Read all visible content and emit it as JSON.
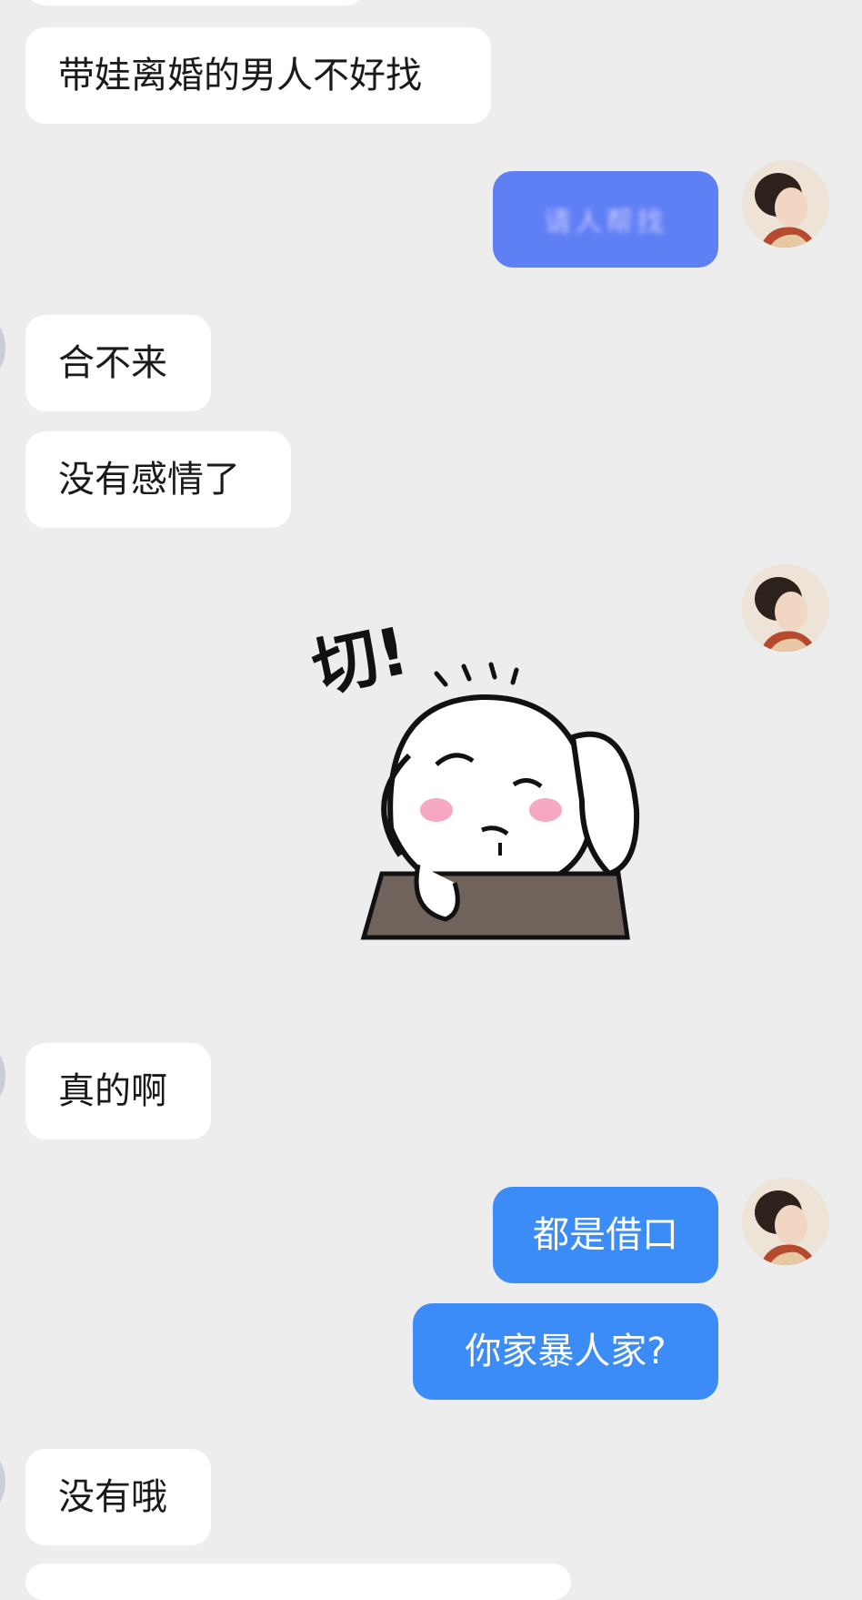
{
  "messages": {
    "m1": "带娃离婚的男人不好找",
    "m2": "请人帮找",
    "m3": "合不来",
    "m4": "没有感情了",
    "m5": "真的啊",
    "m6": "都是借口",
    "m7": "你家暴人家?",
    "m8": "没有哦"
  },
  "sticker": {
    "text": "切!",
    "icon": "bunny-sticker"
  },
  "colors": {
    "background": "#ededed",
    "incoming_bubble": "#ffffff",
    "outgoing_bubble": "#3b8cf7",
    "outgoing_blurred_bubble": "#5f7ff5"
  }
}
